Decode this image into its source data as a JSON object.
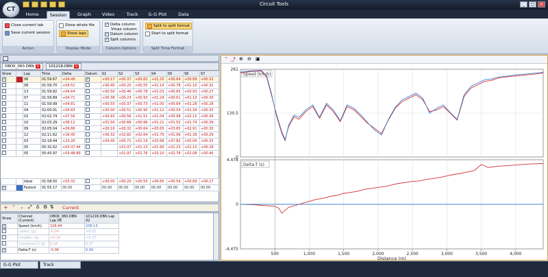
{
  "app": {
    "title": "Circuit Tools",
    "logo": "CT"
  },
  "tabs": [
    "Home",
    "Session",
    "Graph",
    "Video",
    "Track",
    "G-G Plot",
    "Data"
  ],
  "ribbon": {
    "action": {
      "close": "Close current tab",
      "save": "Save current session",
      "title": "Action"
    },
    "display": {
      "whole": "Show whole file",
      "laps": "Show laps",
      "title": "Display Mode"
    },
    "columns": {
      "delta": "Delta column",
      "vmax": "Vmax column",
      "datum": "Datum column",
      "split": "Split columns",
      "title": "Column Options"
    },
    "split": {
      "to": "Split to split format",
      "start": "Start to split format",
      "title": "Split Time Format"
    }
  },
  "files": [
    "DBOX_060.DBN",
    "101218.DBN"
  ],
  "lap_table": {
    "headers": [
      "Show",
      "",
      "Lap",
      "Time",
      "Delta",
      "Datum",
      "S1",
      "S2",
      "S3",
      "S4",
      "S5",
      "S6",
      "S7"
    ],
    "rows": [
      {
        "show": true,
        "lap": "06",
        "time": "01:59.67",
        "delta": "+04.49",
        "datum": true,
        "s": [
          "+00.17",
          "+00.37",
          "+00.82",
          "+01.25",
          "+00.64",
          "+00.89",
          "+00.32"
        ],
        "highlight": true
      },
      {
        "show": false,
        "lap": "08",
        "time": "01:59.70",
        "delta": "+04.52",
        "datum": false,
        "s": [
          "+00.40",
          "+00.20",
          "+00.55",
          "+01.14",
          "+00.78",
          "+01.10",
          "+00.32"
        ]
      },
      {
        "show": false,
        "lap": "13",
        "time": "01:59.82",
        "delta": "+04.64",
        "datum": false,
        "s": [
          "+00.50",
          "+00.46",
          "+00.78",
          "+01.03",
          "+00.65",
          "+00.93",
          "+00.27"
        ]
      },
      {
        "show": false,
        "lap": "07",
        "time": "01:59.89",
        "delta": "+04.71",
        "datum": false,
        "s": [
          "+00.38",
          "+00.23",
          "+00.93",
          "+01.24",
          "+00.61",
          "+01.10",
          "+00.30"
        ]
      },
      {
        "show": false,
        "lap": "11",
        "time": "01:59.99",
        "delta": "+04.81",
        "datum": false,
        "s": [
          "+00.55",
          "+00.37",
          "+00.73",
          "+01.00",
          "+00.64",
          "+01.28",
          "+00.28"
        ]
      },
      {
        "show": false,
        "lap": "04",
        "time": "02:00.01",
        "delta": "+04.83",
        "datum": false,
        "s": [
          "+00.00",
          "+00.51",
          "+00.90",
          "+01.12",
          "+00.54",
          "+01.39",
          "+00.35"
        ]
      },
      {
        "show": false,
        "lap": "02",
        "time": "02:02.74",
        "delta": "+07.56",
        "datum": false,
        "s": [
          "+00.93",
          "+00.56",
          "+01.51",
          "+01.04",
          "+00.98",
          "+02.15",
          "+00.36"
        ]
      },
      {
        "show": false,
        "lap": "10",
        "time": "02:03.29",
        "delta": "+08.12",
        "datum": false,
        "s": [
          "+01.50",
          "+00.68",
          "+00.96",
          "+01.21",
          "+01.52",
          "+01.74",
          "+00.39"
        ]
      },
      {
        "show": false,
        "lap": "09",
        "time": "02:05.04",
        "delta": "+09.86",
        "datum": false,
        "s": [
          "+00.16",
          "+00.32",
          "+00.64",
          "+00.65",
          "+03.65",
          "+02.91",
          "+00.30"
        ]
      },
      {
        "show": false,
        "lap": "12",
        "time": "02:11.62",
        "delta": "+16.45",
        "datum": false,
        "s": [
          "+06.32",
          "+02.82",
          "+02.64",
          "+01.79",
          "+01.06",
          "+01.39",
          "+00.29"
        ]
      },
      {
        "show": false,
        "lap": "03",
        "time": "02:18.44",
        "time_delta": "",
        "delta": "+23.26",
        "datum": false,
        "s": [
          "+04.45",
          "+00.71",
          "+01.19",
          "+03.68",
          "+07.82",
          "+05.04",
          "+00.35"
        ]
      },
      {
        "show": false,
        "lap": "05",
        "time": "05:32.62",
        "delta": "+03:37.44",
        "datum": false,
        "s": [
          "",
          "+01.07",
          "+01.13",
          "+01.90",
          "+01.23",
          "+01.15",
          "+00.28"
        ]
      },
      {
        "show": false,
        "lap": "05",
        "time": "05:43.97",
        "delta": "+03:48.80",
        "datum": false,
        "s": [
          "",
          "+01.97",
          "+01.76",
          "+03.10",
          "+02.78",
          "+02.08",
          "+00.40"
        ]
      }
    ],
    "ideal": {
      "label": "Ideal",
      "time": "01:58.50",
      "delta": "+03.32",
      "s": [
        "+00.00",
        "+00.20",
        "+00.55",
        "+00.85",
        "+00.54",
        "+00.69",
        "+00.27"
      ]
    },
    "fastest": {
      "label": "Fastest",
      "time": "01:55.17",
      "delta": "00.00",
      "s": [
        "00.00",
        "00.00",
        "00.00",
        "00.00",
        "00.00",
        "00.00",
        "00.00"
      ]
    }
  },
  "channel_toolbar": {
    "label": "Current"
  },
  "channel_table": {
    "headers": [
      "Show",
      "Channel (Current)",
      "DBOX_060.DBN Lap 06",
      "101218.DBN Lap 02"
    ],
    "rows": [
      {
        "show": true,
        "name": "Speed (km/h)",
        "a": "226.44",
        "b": "236.13",
        "active": true
      },
      {
        "show": false,
        "name": "LatAcc (g)",
        "a": "-0.04",
        "b": "+0.02",
        "active": false
      },
      {
        "show": false,
        "name": "LongAcc (g)",
        "a": "+0.16",
        "b": "+0.37",
        "active": false
      },
      {
        "show": false,
        "name": "Combined G (g)",
        "a": "0.16",
        "b": "0.37",
        "active": false
      },
      {
        "show": true,
        "name": "Delta-T (s)",
        "a": "-0.06",
        "b": "0.00",
        "active": true
      }
    ]
  },
  "chart_data": [
    {
      "type": "line",
      "title": "Speed (km/h)",
      "xlabel": "Distance (m)",
      "xlim": [
        0,
        4400
      ],
      "ylim": [
        0,
        261
      ],
      "yticks": [
        "261",
        "130.5",
        "0"
      ],
      "x": [
        0,
        150,
        300,
        380,
        450,
        520,
        600,
        650,
        700,
        780,
        850,
        950,
        1050,
        1150,
        1250,
        1350,
        1450,
        1550,
        1650,
        1750,
        1850,
        1950,
        2050,
        2150,
        2250,
        2350,
        2450,
        2550,
        2650,
        2750,
        2850,
        2950,
        3050,
        3150,
        3250,
        3350,
        3450,
        3550,
        3650,
        3750,
        3850,
        3950,
        4050,
        4150,
        4250,
        4400
      ],
      "series": [
        {
          "name": "DBOX_060.DBN Lap 06",
          "color": "#d03030",
          "values": [
            250,
            254,
            256,
            238,
            185,
            130,
            75,
            52,
            90,
            120,
            112,
            135,
            150,
            115,
            155,
            135,
            105,
            150,
            140,
            120,
            100,
            85,
            70,
            110,
            145,
            165,
            175,
            185,
            170,
            135,
            140,
            150,
            130,
            110,
            180,
            205,
            215,
            225,
            228,
            235,
            238,
            240,
            242,
            244,
            246,
            250
          ]
        },
        {
          "name": "101218.DBN Lap 02",
          "color": "#4080d0",
          "values": [
            252,
            256,
            258,
            242,
            190,
            125,
            70,
            48,
            95,
            125,
            118,
            140,
            155,
            118,
            160,
            140,
            108,
            155,
            145,
            125,
            102,
            80,
            65,
            112,
            148,
            170,
            180,
            190,
            175,
            130,
            145,
            155,
            132,
            112,
            185,
            210,
            220,
            230,
            232,
            238,
            240,
            243,
            245,
            247,
            249,
            252
          ]
        }
      ]
    },
    {
      "type": "line",
      "title": "Delta-T (s)",
      "xlabel": "Distance (m)",
      "xlim": [
        0,
        4400
      ],
      "ylim": [
        -4.475,
        4.478
      ],
      "yticks": [
        "4.478",
        "0",
        "-4.475"
      ],
      "x": [
        0,
        200,
        400,
        500,
        560,
        600,
        650,
        700,
        800,
        900,
        1000,
        1100,
        1200,
        1300,
        1400,
        1500,
        1600,
        1700,
        1800,
        1900,
        2000,
        2100,
        2200,
        2300,
        2400,
        2500,
        2600,
        2700,
        2800,
        2900,
        3000,
        3100,
        3200,
        3300,
        3400,
        3500,
        3600,
        3700,
        3800,
        3900,
        4000,
        4100,
        4200,
        4400
      ],
      "series": [
        {
          "name": "DBOX_060.DBN Lap 06",
          "color": "#d03030",
          "values": [
            0,
            -0.05,
            -0.15,
            -0.2,
            -0.4,
            -0.9,
            -0.6,
            -0.3,
            -0.1,
            0.1,
            0.3,
            0.5,
            0.6,
            0.8,
            0.9,
            1.1,
            1.2,
            1.3,
            1.5,
            1.6,
            1.7,
            1.8,
            1.95,
            2.1,
            2.2,
            2.3,
            2.35,
            2.5,
            2.6,
            2.7,
            2.85,
            3.0,
            3.1,
            3.25,
            3.4,
            4.0,
            3.7,
            3.8,
            3.85,
            3.9,
            3.95,
            4.0,
            4.05,
            4.1
          ]
        },
        {
          "name": "101218.DBN Lap 02",
          "color": "#4080d0",
          "values": [
            0,
            0,
            0,
            0,
            0,
            0,
            0,
            0,
            0,
            0,
            0,
            0,
            0,
            0,
            0,
            0,
            0,
            0,
            0,
            0,
            0,
            0,
            0,
            0,
            0,
            0,
            0,
            0,
            0,
            0,
            0,
            0,
            0,
            0,
            0,
            0,
            0,
            0,
            0,
            0,
            0,
            0,
            0,
            0
          ]
        }
      ]
    }
  ],
  "x_ticks": [
    "500",
    "1,000",
    "1,500",
    "2,000",
    "2,500",
    "3,000",
    "3,500",
    "4,000"
  ],
  "bottom_tabs": [
    "G-G Plot",
    "Track"
  ]
}
